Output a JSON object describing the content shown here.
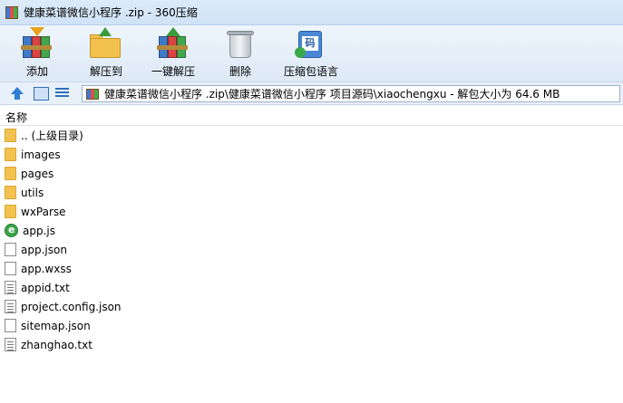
{
  "window": {
    "title": "健康菜谱微信小程序 .zip - 360压缩"
  },
  "toolbar": {
    "items": [
      {
        "label": "添加",
        "icon": "add-archive-icon"
      },
      {
        "label": "解压到",
        "icon": "extract-to-icon"
      },
      {
        "label": "一键解压",
        "icon": "one-click-extract-icon"
      },
      {
        "label": "删除",
        "icon": "delete-icon"
      },
      {
        "label": "压缩包语言",
        "icon": "archive-language-icon"
      }
    ]
  },
  "address": {
    "path": "健康菜谱微信小程序 .zip\\健康菜谱微信小程序 项目源码\\xiaochengxu - 解包大小为 64.6 MB"
  },
  "list": {
    "header": "名称",
    "files": [
      {
        "name": ".. (上级目录)",
        "type": "folder"
      },
      {
        "name": "images",
        "type": "folder"
      },
      {
        "name": "pages",
        "type": "folder"
      },
      {
        "name": "utils",
        "type": "folder"
      },
      {
        "name": "wxParse",
        "type": "folder"
      },
      {
        "name": "app.js",
        "type": "js"
      },
      {
        "name": "app.json",
        "type": "doc"
      },
      {
        "name": "app.wxss",
        "type": "doc"
      },
      {
        "name": "appid.txt",
        "type": "txt"
      },
      {
        "name": "project.config.json",
        "type": "txt"
      },
      {
        "name": "sitemap.json",
        "type": "doc"
      },
      {
        "name": "zhanghao.txt",
        "type": "txt"
      }
    ]
  }
}
